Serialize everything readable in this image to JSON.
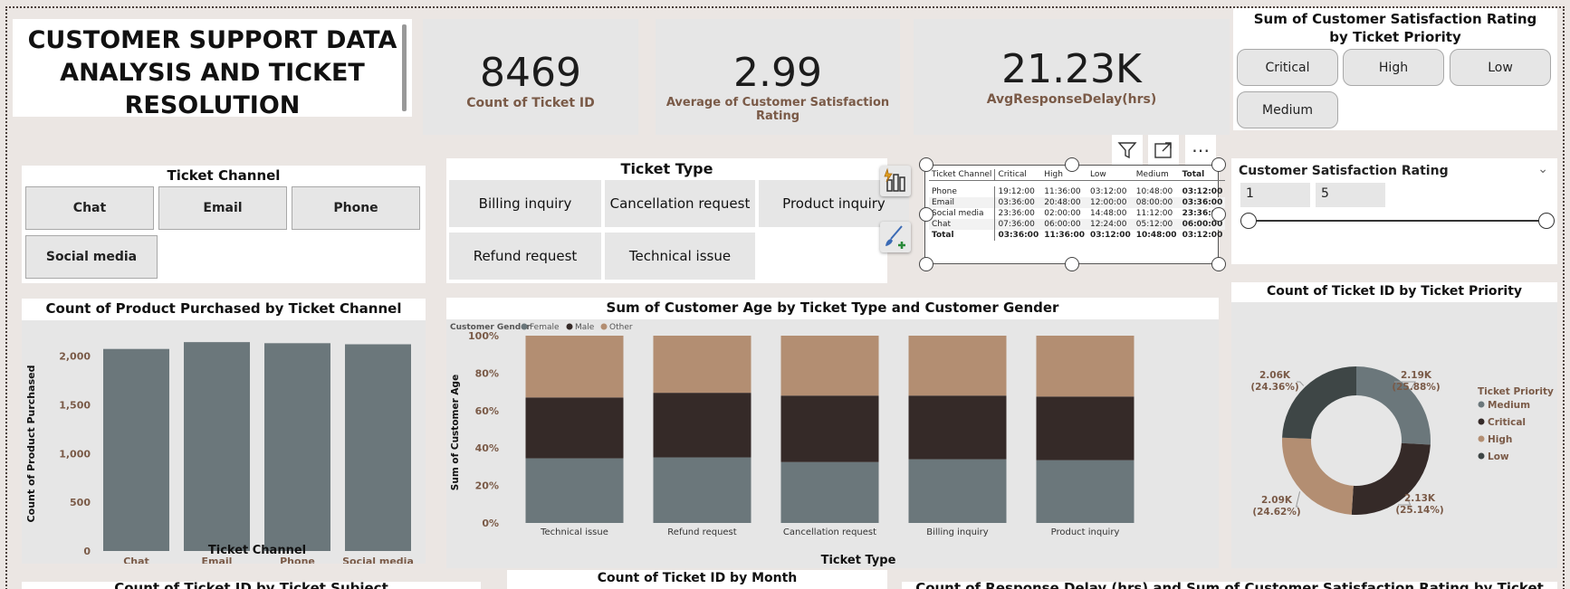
{
  "dashboard": {
    "title": "CUSTOMER SUPPORT DATA ANALYSIS AND TICKET RESOLUTION"
  },
  "kpis": [
    {
      "value": "8469",
      "label": "Count of Ticket ID"
    },
    {
      "value": "2.99",
      "label": "Average of Customer Satisfaction Rating"
    },
    {
      "value": "21.23K",
      "label": "AvgResponseDelay(hrs)"
    }
  ],
  "priority_slicer": {
    "title": "Sum of Customer Satisfaction Rating by Ticket Priority",
    "options": [
      "Critical",
      "High",
      "Low",
      "Medium"
    ]
  },
  "channel_slicer": {
    "title": "Ticket Channel",
    "options": [
      "Chat",
      "Email",
      "Phone",
      "Social media"
    ]
  },
  "type_slicer": {
    "title": "Ticket Type",
    "options": [
      "Billing inquiry",
      "Cancellation request",
      "Product inquiry",
      "Refund request",
      "Technical issue"
    ]
  },
  "matrix": {
    "headers": [
      "Ticket Channel",
      "Critical",
      "High",
      "Low",
      "Medium",
      "Total"
    ],
    "rows": [
      [
        "Phone",
        "19:12:00",
        "11:36:00",
        "03:12:00",
        "10:48:00",
        "03:12:00"
      ],
      [
        "Email",
        "03:36:00",
        "20:48:00",
        "12:00:00",
        "08:00:00",
        "03:36:00"
      ],
      [
        "Social media",
        "23:36:00",
        "02:00:00",
        "14:48:00",
        "11:12:00",
        "23:36:00"
      ],
      [
        "Chat",
        "07:36:00",
        "06:00:00",
        "12:24:00",
        "05:12:00",
        "06:00:00"
      ],
      [
        "Total",
        "03:36:00",
        "11:36:00",
        "03:12:00",
        "10:48:00",
        "03:12:00"
      ]
    ]
  },
  "rating_slicer": {
    "title": "Customer Satisfaction Rating",
    "min": "1",
    "max": "5"
  },
  "colors": {
    "slate": "#6b777b",
    "dark": "#352a28",
    "tan": "#b38e72",
    "charcoal": "#3e4646",
    "label_brown": "#7a5a47"
  },
  "icons": [
    "filter-icon",
    "focus-mode-icon",
    "more-options-icon",
    "build-visual-icon",
    "format-visual-icon",
    "chevron-down-icon"
  ],
  "bottom_titles": {
    "left": "Count of Ticket ID by Ticket Subject",
    "mid": "Count of Ticket ID by Month",
    "right": "Count of Response Delay (hrs) and Sum of Customer Satisfaction Rating by Ticket Type"
  },
  "chart_data": [
    {
      "type": "bar",
      "title": "Count of Product Purchased by Ticket Channel",
      "xlabel": "Ticket Channel",
      "ylabel": "Count of Product Purchased",
      "categories": [
        "Chat",
        "Email",
        "Phone",
        "Social media"
      ],
      "values": [
        2073,
        2143,
        2132,
        2121
      ],
      "ylim": [
        0,
        2200
      ],
      "yticks": [
        "0",
        "500",
        "1,000",
        "1,500",
        "2,000"
      ],
      "grid": false
    },
    {
      "type": "bar",
      "stacked_percent": true,
      "title": "Sum of Customer Age by Ticket Type and Customer Gender",
      "xlabel": "Ticket Type",
      "ylabel": "Sum of Customer Age",
      "legend_title": "Customer Gender",
      "legend_position": "top-left",
      "categories": [
        "Technical issue",
        "Refund request",
        "Cancellation request",
        "Billing inquiry",
        "Product inquiry"
      ],
      "yticks": [
        "0%",
        "20%",
        "40%",
        "60%",
        "80%",
        "100%"
      ],
      "series": [
        {
          "name": "Female",
          "values": [
            34.5,
            35.0,
            32.5,
            34.0,
            33.5
          ]
        },
        {
          "name": "Male",
          "values": [
            32.5,
            34.5,
            35.5,
            34.0,
            34.0
          ]
        },
        {
          "name": "Other",
          "values": [
            33.0,
            30.5,
            32.0,
            32.0,
            32.5
          ]
        }
      ]
    },
    {
      "type": "pie",
      "donut": true,
      "title": "Count of Ticket ID by Ticket Priority",
      "legend_title": "Ticket Priority",
      "legend_position": "right",
      "labels": [
        "Medium",
        "Critical",
        "High",
        "Low"
      ],
      "values": [
        2192,
        2129,
        2085,
        2063
      ],
      "display_values": [
        "2.19K",
        "2.13K",
        "2.09K",
        "2.06K"
      ],
      "display_percents": [
        "(25.88%)",
        "(25.14%)",
        "(24.62%)",
        "(24.36%)"
      ]
    }
  ]
}
